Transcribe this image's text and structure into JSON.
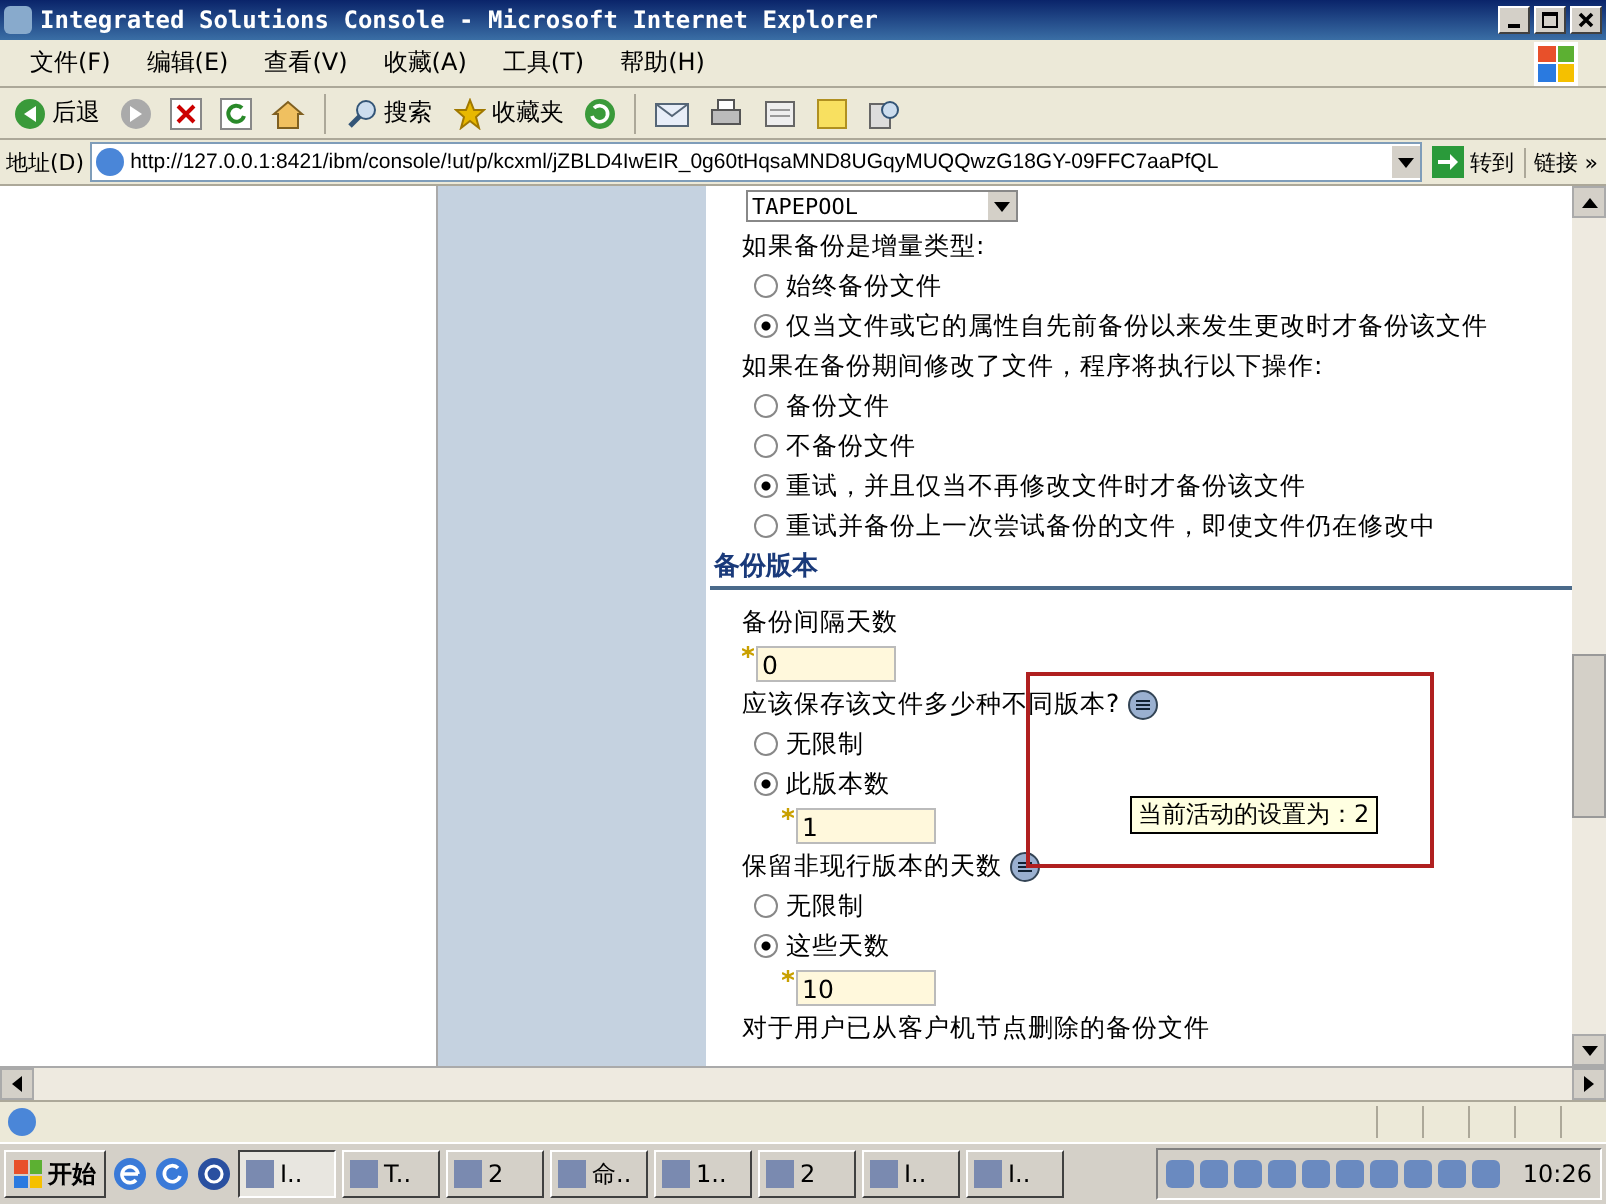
{
  "window": {
    "title": "Integrated Solutions Console - Microsoft Internet Explorer"
  },
  "menu": [
    "文件(F)",
    "编辑(E)",
    "查看(V)",
    "收藏(A)",
    "工具(T)",
    "帮助(H)"
  ],
  "toolbar": {
    "back": "后退",
    "search": "搜索",
    "favorites": "收藏夹"
  },
  "address": {
    "label": "地址(D)",
    "url": "http://127.0.0.1:8421/ibm/console/!ut/p/kcxml/jZBLD4IwEIR_0g60tHqsaMND8UGqyMUQQwzG18GY-09FFC7aaPfQL",
    "go": "转到",
    "links": "链接 »"
  },
  "content": [
    {
      "kind": "select",
      "value": "TAPEPOOL"
    },
    {
      "kind": "label",
      "text": "如果备份是增量类型:"
    },
    {
      "kind": "radio",
      "text": "始终备份文件",
      "selected": false
    },
    {
      "kind": "radio",
      "text": "仅当文件或它的属性自先前备份以来发生更改时才备份该文件",
      "selected": true
    },
    {
      "kind": "label",
      "text": "如果在备份期间修改了文件，程序将执行以下操作:"
    },
    {
      "kind": "radio",
      "text": "备份文件",
      "selected": false
    },
    {
      "kind": "radio",
      "text": "不备份文件",
      "selected": false
    },
    {
      "kind": "radio",
      "text": "重试，并且仅当不再修改文件时才备份该文件",
      "selected": true
    },
    {
      "kind": "radio",
      "text": "重试并备份上一次尝试备份的文件，即使文件仍在修改中",
      "selected": false
    },
    {
      "kind": "heading",
      "text": "备份版本"
    },
    {
      "kind": "label",
      "text": "备份间隔天数"
    },
    {
      "kind": "field",
      "value": "0"
    },
    {
      "kind": "help",
      "text": "应该保存该文件多少种不同版本?"
    },
    {
      "kind": "radio",
      "text": "无限制",
      "selected": false
    },
    {
      "kind": "radio",
      "text": "此版本数",
      "selected": true
    },
    {
      "kind": "subfield",
      "value": "1"
    },
    {
      "kind": "help",
      "text": "保留非现行版本的天数"
    },
    {
      "kind": "radio",
      "text": "无限制",
      "selected": false
    },
    {
      "kind": "radio",
      "text": "这些天数",
      "selected": true
    },
    {
      "kind": "subfield",
      "value": "10"
    },
    {
      "kind": "label",
      "text": "对于用户已从客户机节点删除的备份文件"
    }
  ],
  "tooltip": "当前活动的设置为：2",
  "taskbar": {
    "start": "开始",
    "tasks": [
      "I..",
      "T..",
      "2",
      "命..",
      "1..",
      "2",
      "I..",
      "I.."
    ],
    "clock": "10:26"
  }
}
